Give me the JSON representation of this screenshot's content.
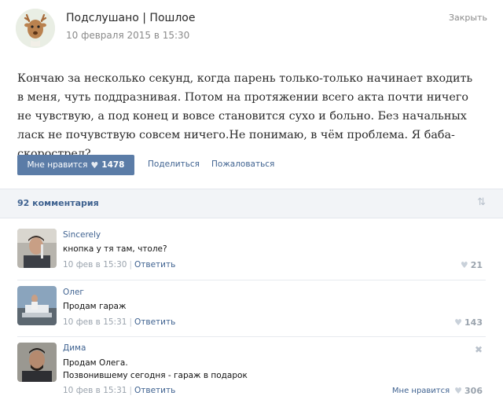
{
  "post": {
    "group_name": "Подслушано | Пошлое",
    "date": "10 февраля 2015 в 15:30",
    "close_label": "Закрыть",
    "text": "Кончаю за несколько секунд, когда парень только-только начинает входить в меня, чуть поддразнивая. Потом на протяжении всего акта почти ничего не чувствую, а под конец и вовсе становится сухо и больно. Без начальных ласк не почувствую совсем ничего.Не понимаю, в чём проблема. Я баба-скорострел?",
    "like_label": "Мне нравится",
    "like_count": "1478",
    "share_label": "Поделиться",
    "report_label": "Пожаловаться",
    "avatar_icon": "deer-icon"
  },
  "comments_header": {
    "count_label": "92 комментария",
    "sort_icon": "sort-icon"
  },
  "comments": [
    {
      "author": "Sincerely",
      "text": "кнопка у тя там, чтоле?",
      "time": "10 фев в 15:30",
      "reply": "Ответить",
      "likes": "21"
    },
    {
      "author": "Олег",
      "text": "Продам гараж",
      "time": "10 фев в 15:31",
      "reply": "Ответить",
      "likes": "143"
    },
    {
      "author": "Дима",
      "text_line1": "Продам Олега.",
      "text_line2": "Позвонившему сегодня - гараж в подарок",
      "time": "10 фев в 15:31",
      "reply": "Ответить",
      "like_label": "Мне нравится",
      "likes": "306"
    }
  ],
  "colors": {
    "accent": "#5b7ca7",
    "link": "#3f6290"
  }
}
